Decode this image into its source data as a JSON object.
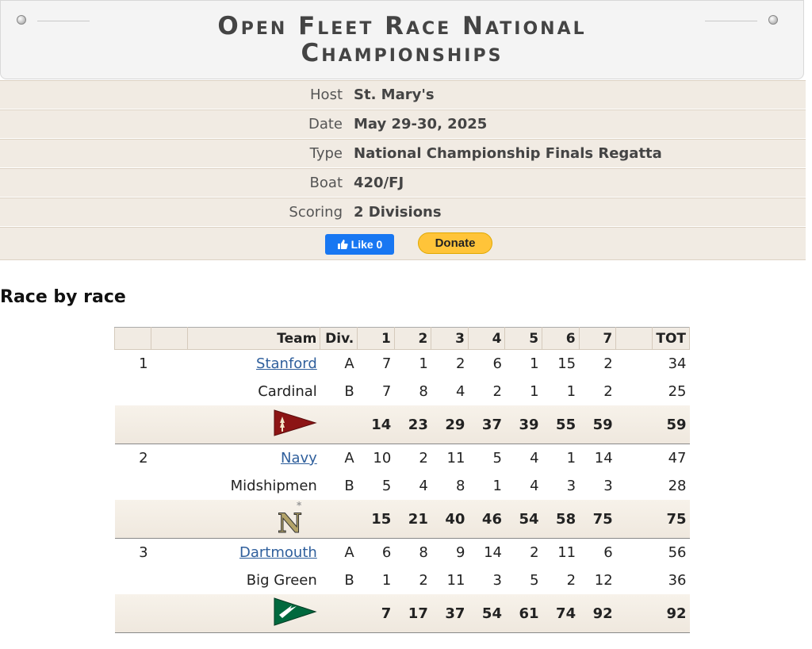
{
  "regatta": {
    "title_line1": "Open Fleet Race National",
    "title_line2": "Championships"
  },
  "info": [
    {
      "label": "Host",
      "value": "St. Mary's"
    },
    {
      "label": "Date",
      "value": "May 29-30, 2025"
    },
    {
      "label": "Type",
      "value": "National Championship Finals Regatta"
    },
    {
      "label": "Boat",
      "value": "420/FJ"
    },
    {
      "label": "Scoring",
      "value": "2 Divisions"
    }
  ],
  "social": {
    "fb_label": "Like 0",
    "donate_label": "Donate"
  },
  "section": {
    "title": "Race by race"
  },
  "table": {
    "headers": [
      "Team",
      "Div.",
      "1",
      "2",
      "3",
      "4",
      "5",
      "6",
      "7",
      "TOT"
    ],
    "teams": [
      {
        "rank": "1",
        "school": "Stanford",
        "mascot": "Cardinal",
        "a": [
          "A",
          "7",
          "1",
          "2",
          "6",
          "1",
          "15",
          "2",
          "34"
        ],
        "b": [
          "B",
          "7",
          "8",
          "4",
          "2",
          "1",
          "1",
          "2",
          "25"
        ],
        "cum": [
          "14",
          "23",
          "29",
          "37",
          "39",
          "55",
          "59",
          "59"
        ],
        "burgee_color": "#8c1515"
      },
      {
        "rank": "2",
        "school": "Navy",
        "mascot": "Midshipmen",
        "a": [
          "A",
          "10",
          "2",
          "11",
          "5",
          "4",
          "1",
          "14",
          "47"
        ],
        "b": [
          "B",
          "5",
          "4",
          "8",
          "1",
          "4",
          "3",
          "3",
          "28"
        ],
        "cum": [
          "15",
          "21",
          "40",
          "46",
          "54",
          "58",
          "75",
          "75"
        ],
        "burgee_color": "#b3a369"
      },
      {
        "rank": "3",
        "school": "Dartmouth",
        "mascot": "Big Green",
        "a": [
          "A",
          "6",
          "8",
          "9",
          "14",
          "2",
          "11",
          "6",
          "56"
        ],
        "b": [
          "B",
          "1",
          "2",
          "11",
          "3",
          "5",
          "2",
          "12",
          "36"
        ],
        "cum": [
          "7",
          "17",
          "37",
          "54",
          "61",
          "74",
          "92",
          "92"
        ],
        "burgee_color": "#00693e"
      }
    ]
  }
}
